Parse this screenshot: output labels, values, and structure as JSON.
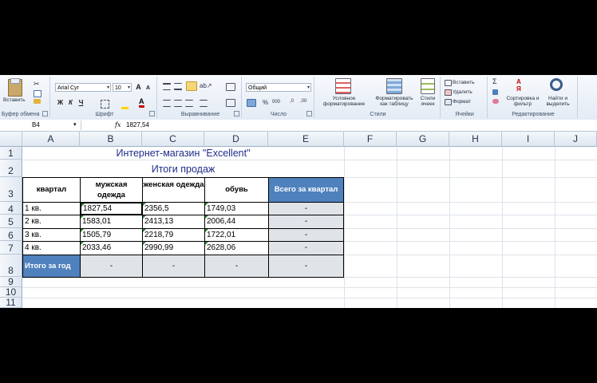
{
  "ribbon": {
    "clipboard": {
      "label": "Буфер обмена",
      "paste_label": "Вставить"
    },
    "font": {
      "label": "Шрифт",
      "font_name": "Arial Cyr",
      "font_size": "10",
      "bold": "Ж",
      "italic": "К",
      "underline": "Ч",
      "grow": "A",
      "shrink": "A"
    },
    "alignment": {
      "label": "Выравнивание"
    },
    "number": {
      "label": "Число",
      "format": "Общий",
      "percent": "%",
      "thousands": "000"
    },
    "styles": {
      "label": "Стили",
      "conditional": "Условное форматирование",
      "as_table": "Форматировать как таблицу",
      "cell_styles": "Стили ячеек"
    },
    "cells": {
      "label": "Ячейки",
      "insert": "Вставить",
      "delete": "Удалить",
      "format": "Формат"
    },
    "editing": {
      "label": "Редактирование",
      "sort": "Сортировка и фильтр",
      "find": "Найти и выделить",
      "sigma": "Σ"
    }
  },
  "formula_bar": {
    "name_box": "B4",
    "fx": "fx",
    "value": "1827,54"
  },
  "columns": [
    "A",
    "B",
    "C",
    "D",
    "E",
    "F",
    "G",
    "H",
    "I",
    "J"
  ],
  "rows": [
    "1",
    "2",
    "3",
    "4",
    "5",
    "6",
    "7",
    "8",
    "9",
    "10",
    "11"
  ],
  "sheet": {
    "title": "Интернет-магазин \"Excellent\"",
    "subtitle": "Итоги продаж",
    "headers": {
      "quarter": "квартал",
      "men": "мужская одежда",
      "women": "женская одежда",
      "shoes": "обувь",
      "total_quarter": "Всего за квартал"
    },
    "data_rows": [
      {
        "quarter": "1 кв.",
        "men": "1827,54",
        "women": "2356,5",
        "shoes": "1749,03",
        "total": "-"
      },
      {
        "quarter": "2 кв.",
        "men": "1583,01",
        "women": "2413,13",
        "shoes": "2006,44",
        "total": "-"
      },
      {
        "quarter": "3 кв.",
        "men": "1505,79",
        "women": "2218,79",
        "shoes": "1722,01",
        "total": "-"
      },
      {
        "quarter": "4 кв.",
        "men": "2033,46",
        "women": "2990,99",
        "shoes": "2628,06",
        "total": "-"
      }
    ],
    "total_row": {
      "label": "Итого за год",
      "men": "-",
      "women": "-",
      "shoes": "-",
      "total": "-"
    }
  },
  "colors": {
    "header_blue": "#4f81bd",
    "total_grey": "#e0e4e9",
    "title_blue": "#1f2d8a"
  }
}
